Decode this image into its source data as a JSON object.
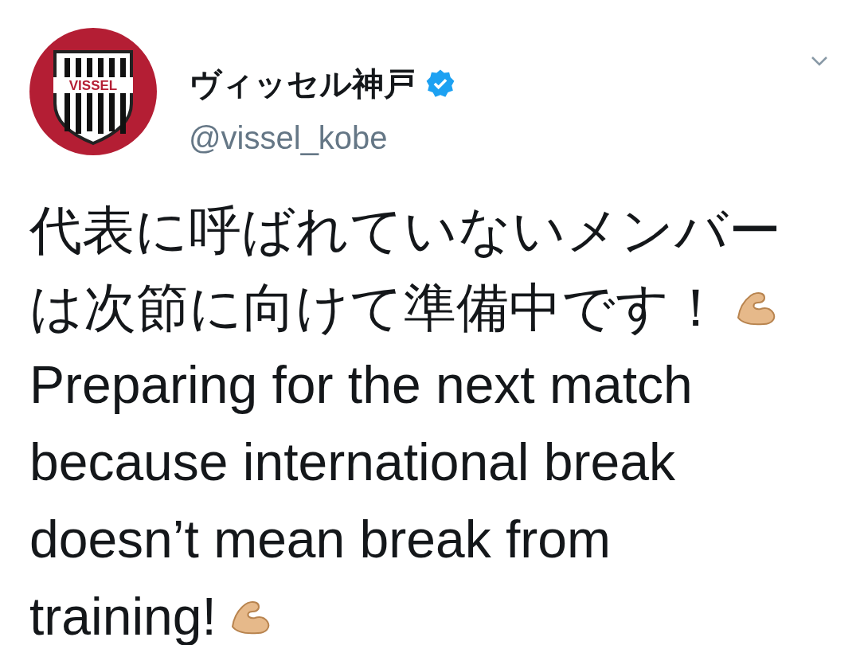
{
  "account": {
    "logo_text": "VISSEL",
    "name": "ヴィッセル神戸",
    "verified": true,
    "handle": "@vissel_kobe"
  },
  "tweet": {
    "paragraphs": [
      {
        "text": "代表に呼ばれていないメンバーは次節に向けて準備中です！",
        "ends_with_arm_icon": true
      },
      {
        "text": "Preparing for the next match because international break doesn’t mean break from training!",
        "ends_with_arm_icon": true
      }
    ]
  }
}
